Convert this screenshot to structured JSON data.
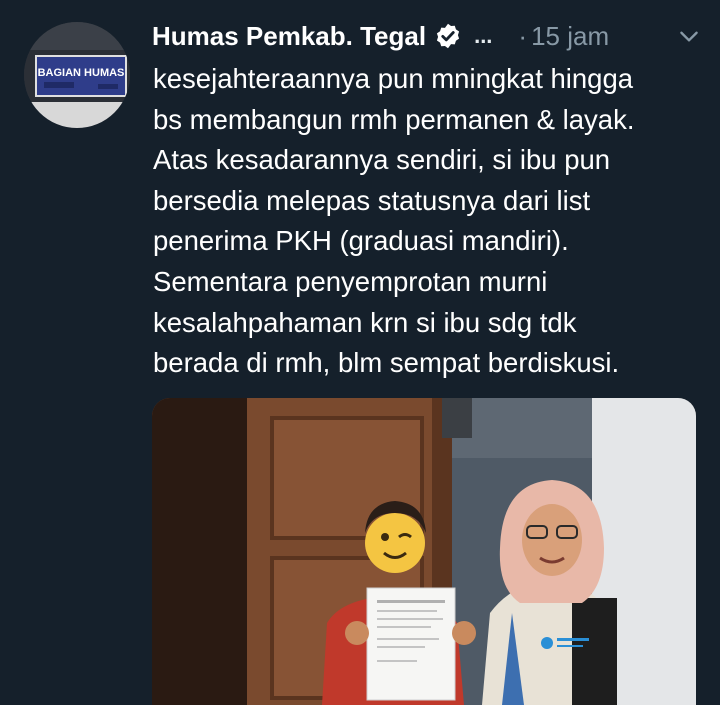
{
  "tweet": {
    "author_name": "Humas Pemkab. Tegal",
    "verified": true,
    "more_label": "...",
    "separator": "·",
    "time": "15 jam",
    "text_lines": [
      "kesejahteraannya pun mningkat hingga",
      "bs membangun rmh permanen & layak.",
      "Atas kesadarannya sendiri, si ibu pun",
      "bersedia melepas statusnya dari list",
      "penerima PKH (graduasi mandiri).",
      "Sementara penyemprotan murni",
      "kesalahpahaman krn si ibu sdg tdk",
      "berada di rmh, blm sempat berdiskusi."
    ],
    "avatar_sign_text": "BAGIAN HUMAS"
  },
  "icons": {
    "verified": "verified-badge-icon",
    "chevron": "chevron-down-icon",
    "face": "winking-face-emoji"
  },
  "colors": {
    "background": "#15202b",
    "text": "#ffffff",
    "muted": "#8899a6"
  }
}
